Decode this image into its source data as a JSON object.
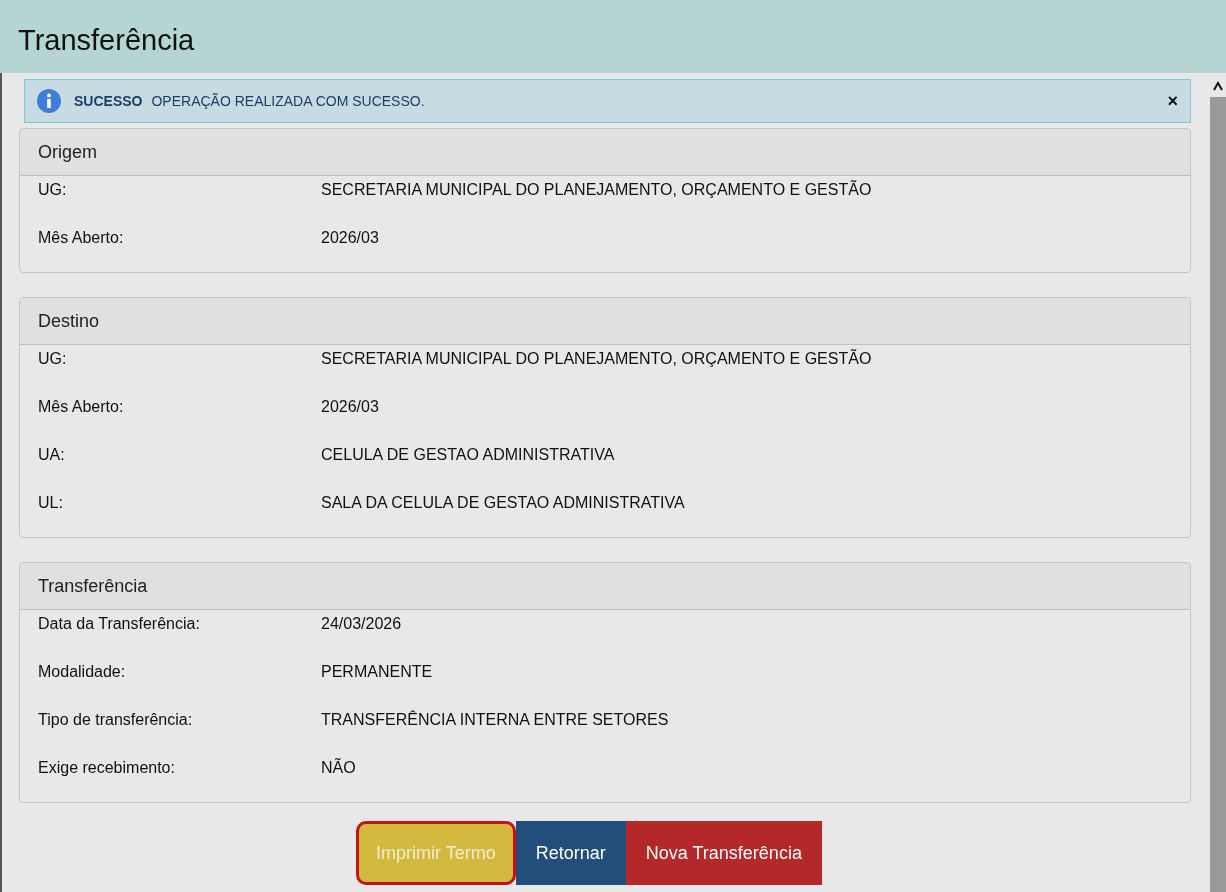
{
  "window": {
    "title": "Transferência"
  },
  "alert": {
    "kind": "info",
    "title": "SUCESSO",
    "message": "OPERAÇÃO REALIZADA COM SUCESSO.",
    "close": "×"
  },
  "panels": [
    {
      "title": "Origem",
      "rows": [
        {
          "label": "UG:",
          "value": "SECRETARIA MUNICIPAL DO PLANEJAMENTO, ORÇAMENTO E GESTÃO"
        },
        {
          "label": "Mês Aberto:",
          "value": "2026/03"
        }
      ]
    },
    {
      "title": "Destino",
      "rows": [
        {
          "label": "UG:",
          "value": "SECRETARIA MUNICIPAL DO PLANEJAMENTO, ORÇAMENTO E GESTÃO"
        },
        {
          "label": "Mês Aberto:",
          "value": "2026/03"
        },
        {
          "label": "UA:",
          "value": "CELULA DE GESTAO ADMINISTRATIVA"
        },
        {
          "label": "UL:",
          "value": "SALA DA CELULA DE GESTAO ADMINISTRATIVA"
        }
      ]
    },
    {
      "title": "Transferência",
      "rows": [
        {
          "label": "Data da Transferência:",
          "value": "24/03/2026"
        },
        {
          "label": "Modalidade:",
          "value": "PERMANENTE"
        },
        {
          "label": "Tipo de transferência:",
          "value": "TRANSFERÊNCIA INTERNA ENTRE SETORES"
        },
        {
          "label": "Exige recebimento:",
          "value": "NÃO"
        }
      ]
    }
  ],
  "buttons": [
    {
      "label": "Imprimir Termo",
      "kind": "warning",
      "highlighted": true
    },
    {
      "label": "Retornar",
      "kind": "primary",
      "highlighted": false
    },
    {
      "label": "Nova Transferência",
      "kind": "danger",
      "highlighted": false
    }
  ]
}
